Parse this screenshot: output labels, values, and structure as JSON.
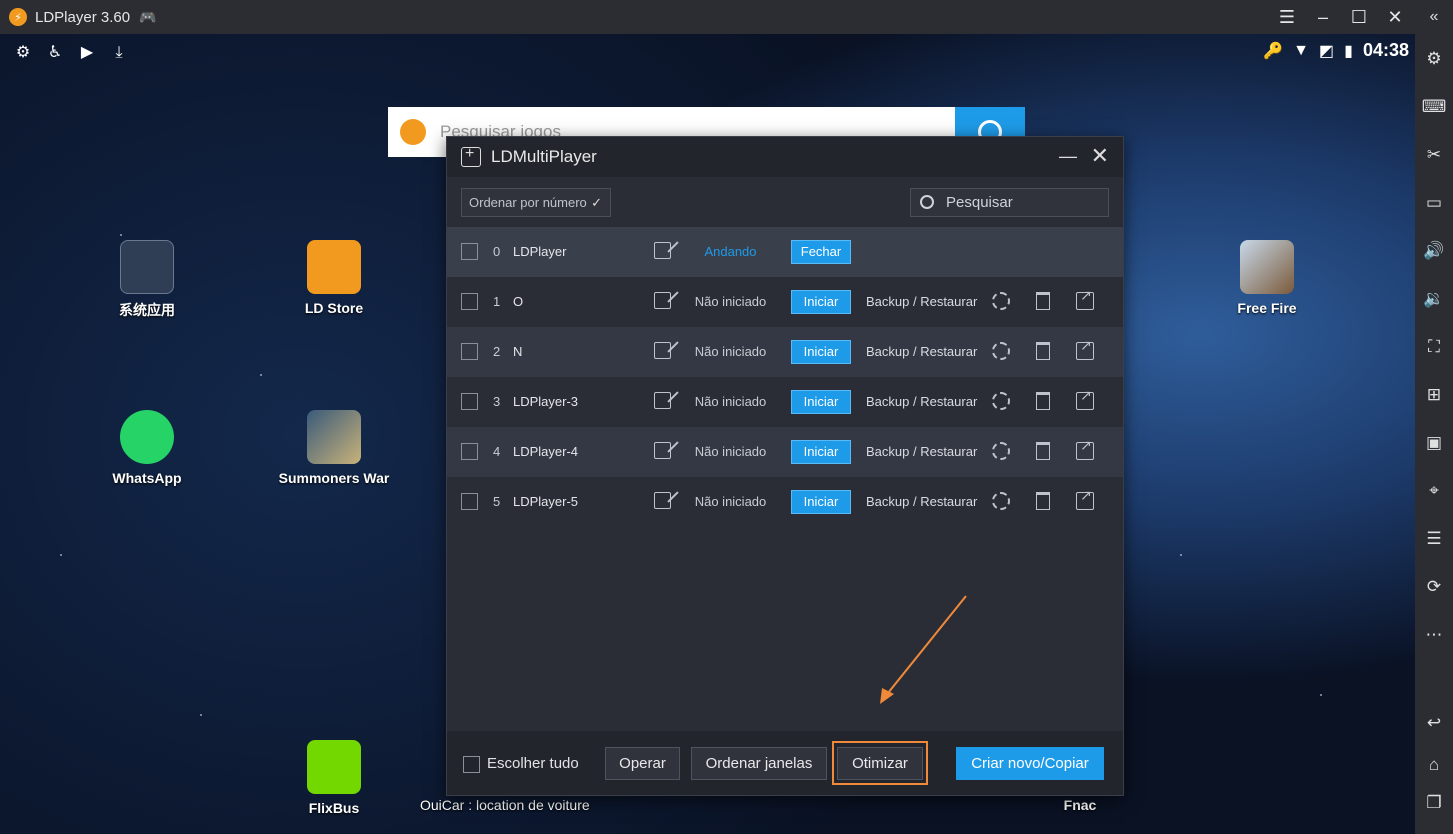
{
  "titlebar": {
    "title": "LDPlayer 3.60",
    "minimize": "–",
    "maximize": "☐",
    "close": "✕",
    "menu": "☰",
    "collapse": "«"
  },
  "statusbar": {
    "time": "04:38"
  },
  "search": {
    "placeholder": "Pesquisar jogos"
  },
  "desktop": {
    "apps": [
      {
        "label": "系统应用"
      },
      {
        "label": "LD Store"
      },
      {
        "label": "Free Fire"
      },
      {
        "label": "WhatsApp"
      },
      {
        "label": "Summoners War"
      },
      {
        "label": "FlixBus"
      },
      {
        "label": "OuiCar : location de voiture"
      },
      {
        "label": "Fnac"
      }
    ]
  },
  "multiplayer": {
    "title": "LDMultiPlayer",
    "sort_label": "Ordenar por número",
    "search_placeholder": "Pesquisar",
    "instances": [
      {
        "index": "0",
        "name": "LDPlayer",
        "status": "Andando",
        "action": "Fechar"
      },
      {
        "index": "1",
        "name": "O",
        "status": "Não iniciado",
        "action": "Iniciar",
        "backup": "Backup / Restaurar"
      },
      {
        "index": "2",
        "name": "N",
        "status": "Não iniciado",
        "action": "Iniciar",
        "backup": "Backup / Restaurar"
      },
      {
        "index": "3",
        "name": "LDPlayer-3",
        "status": "Não iniciado",
        "action": "Iniciar",
        "backup": "Backup / Restaurar"
      },
      {
        "index": "4",
        "name": "LDPlayer-4",
        "status": "Não iniciado",
        "action": "Iniciar",
        "backup": "Backup / Restaurar"
      },
      {
        "index": "5",
        "name": "LDPlayer-5",
        "status": "Não iniciado",
        "action": "Iniciar",
        "backup": "Backup / Restaurar"
      }
    ],
    "footer": {
      "select_all": "Escolher tudo",
      "operate": "Operar",
      "arrange": "Ordenar janelas",
      "optimize": "Otimizar",
      "create": "Criar novo/Copiar"
    }
  },
  "colors": {
    "accent": "#1e9be8",
    "highlight": "#f08a3a"
  }
}
